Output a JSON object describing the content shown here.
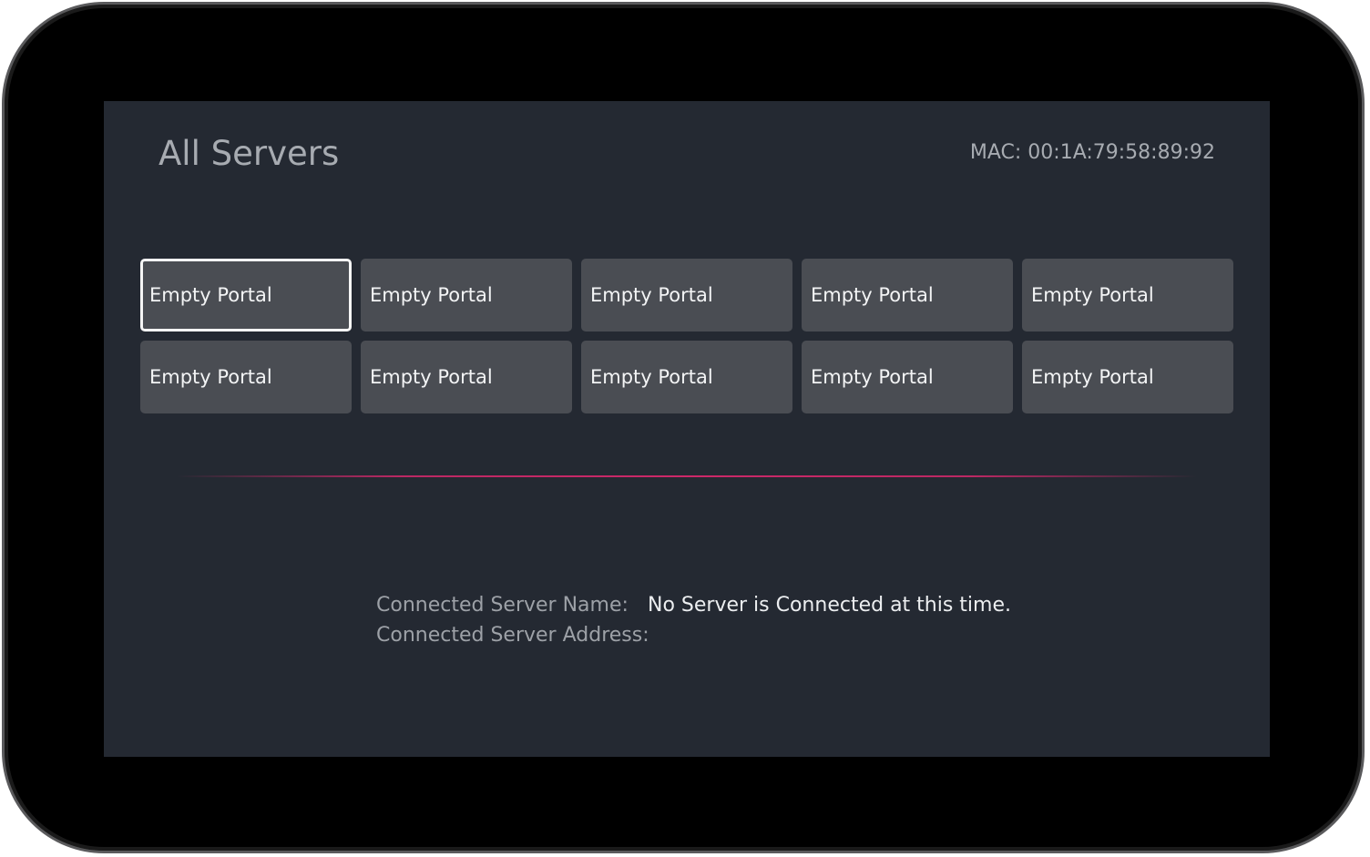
{
  "header": {
    "title": "All Servers",
    "mac": "MAC: 00:1A:79:58:89:92"
  },
  "portals": [
    {
      "label": "Empty Portal",
      "selected": true
    },
    {
      "label": "Empty Portal",
      "selected": false
    },
    {
      "label": "Empty Portal",
      "selected": false
    },
    {
      "label": "Empty Portal",
      "selected": false
    },
    {
      "label": "Empty Portal",
      "selected": false
    },
    {
      "label": "Empty Portal",
      "selected": false
    },
    {
      "label": "Empty Portal",
      "selected": false
    },
    {
      "label": "Empty Portal",
      "selected": false
    },
    {
      "label": "Empty Portal",
      "selected": false
    },
    {
      "label": "Empty Portal",
      "selected": false
    }
  ],
  "connection": {
    "name_label": "Connected Server Name:",
    "name_value": "No Server is Connected at this time.",
    "address_label": "Connected Server Address:",
    "address_value": ""
  },
  "colors": {
    "screen_background": "#242932",
    "tile_background": "#4a4d53",
    "divider_accent": "#d6286c",
    "selected_border": "#f5f5f5"
  }
}
